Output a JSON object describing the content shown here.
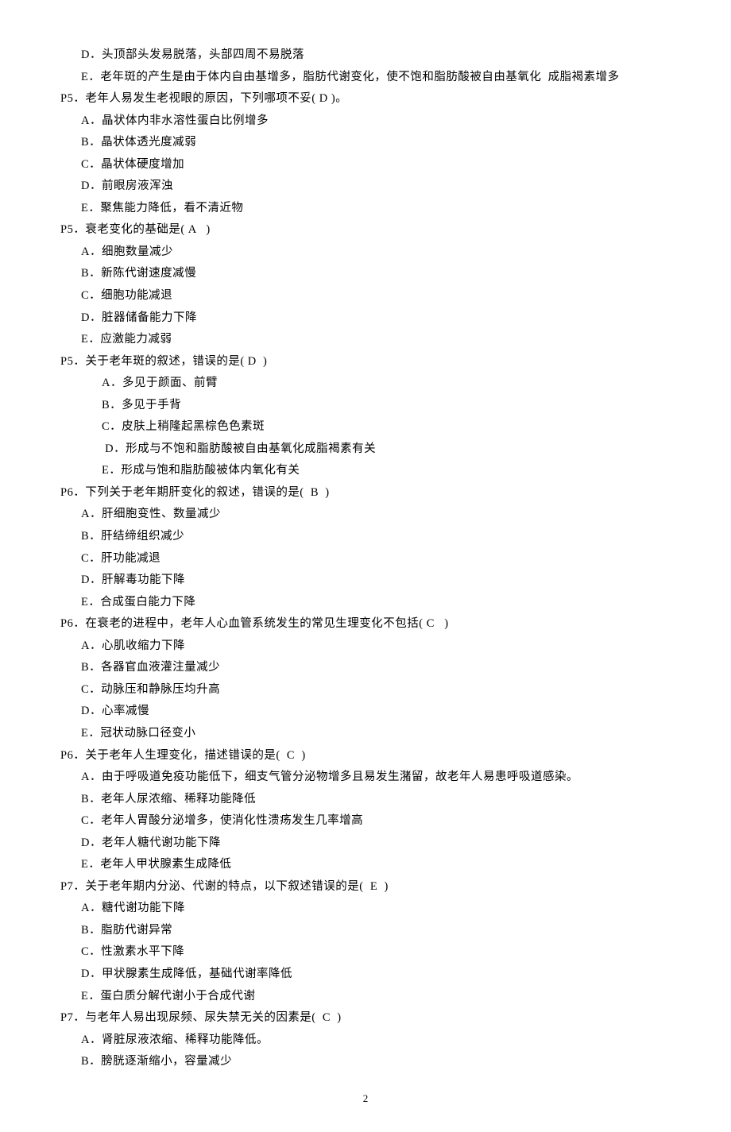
{
  "lines": [
    {
      "cls": "opt",
      "text": "D．头顶部头发易脱落，头部四周不易脱落"
    },
    {
      "cls": "opt",
      "text": "E．老年斑的产生是由于体内自由基增多，脂肪代谢变化，使不饱和脂肪酸被自由基氧化  成脂褐素增多"
    },
    {
      "cls": "q-line",
      "text": "P5．老年人易发生老视眼的原因，下列哪项不妥( D )。"
    },
    {
      "cls": "opt",
      "text": "A．晶状体内非水溶性蛋白比例增多"
    },
    {
      "cls": "opt",
      "text": "B．晶状体透光度减弱"
    },
    {
      "cls": "opt",
      "text": "C．晶状体硬度增加"
    },
    {
      "cls": "opt",
      "text": "D．前眼房液浑浊"
    },
    {
      "cls": "opt",
      "text": "E．聚焦能力降低，看不清近物"
    },
    {
      "cls": "q-line",
      "text": "P5．衰老变化的基础是( A   )"
    },
    {
      "cls": "opt",
      "text": "A．细胞数量减少"
    },
    {
      "cls": "opt",
      "text": "B．新陈代谢速度减慢"
    },
    {
      "cls": "opt",
      "text": "C．细胞功能减退"
    },
    {
      "cls": "opt",
      "text": "D．脏器储备能力下降"
    },
    {
      "cls": "opt",
      "text": "E．应激能力减弱"
    },
    {
      "cls": "q-line",
      "text": "P5．关于老年斑的叙述，错误的是( D  )"
    },
    {
      "cls": "opt-indent",
      "text": "A．多见于颜面、前臂"
    },
    {
      "cls": "opt-indent",
      "text": "B．多见于手背"
    },
    {
      "cls": "opt-indent",
      "text": "C．皮肤上稍隆起黑棕色色素斑"
    },
    {
      "cls": "opt-indent",
      "text": " D．形成与不饱和脂肪酸被自由基氧化成脂褐素有关"
    },
    {
      "cls": "opt-indent",
      "text": "E．形成与饱和脂肪酸被体内氧化有关"
    },
    {
      "cls": "q-line",
      "text": "P6．下列关于老年期肝变化的叙述，错误的是(  B  )"
    },
    {
      "cls": "opt",
      "text": "A．肝细胞变性、数量减少"
    },
    {
      "cls": "opt",
      "text": "B．肝结缔组织减少"
    },
    {
      "cls": "opt",
      "text": "C．肝功能减退"
    },
    {
      "cls": "opt",
      "text": "D．肝解毒功能下降"
    },
    {
      "cls": "opt",
      "text": "E．合成蛋白能力下降"
    },
    {
      "cls": "q-line",
      "text": "P6．在衰老的进程中，老年人心血管系统发生的常见生理变化不包括( C   )"
    },
    {
      "cls": "opt",
      "text": "A．心肌收缩力下降"
    },
    {
      "cls": "opt",
      "text": "B．各器官血液灌注量减少"
    },
    {
      "cls": "opt",
      "text": "C．动脉压和静脉压均升高"
    },
    {
      "cls": "opt",
      "text": "D．心率减慢"
    },
    {
      "cls": "opt",
      "text": "E．冠状动脉口径变小"
    },
    {
      "cls": "q-line",
      "text": "P6．关于老年人生理变化，描述错误的是(  C  )"
    },
    {
      "cls": "opt",
      "text": "A．由于呼吸道免疫功能低下，细支气管分泌物增多且易发生潴留，故老年人易患呼吸道感染。"
    },
    {
      "cls": "opt",
      "text": "B．老年人尿浓缩、稀释功能降低"
    },
    {
      "cls": "opt",
      "text": "C．老年人胃酸分泌增多，使消化性溃疡发生几率增高"
    },
    {
      "cls": "opt",
      "text": "D．老年人糖代谢功能下降"
    },
    {
      "cls": "opt",
      "text": "E．老年人甲状腺素生成降低"
    },
    {
      "cls": "q-line",
      "text": "P7．关于老年期内分泌、代谢的特点，以下叙述错误的是(  E  )"
    },
    {
      "cls": "opt",
      "text": "A．糖代谢功能下降"
    },
    {
      "cls": "opt",
      "text": "B．脂肪代谢异常"
    },
    {
      "cls": "opt",
      "text": "C．性激素水平下降"
    },
    {
      "cls": "opt",
      "text": "D．甲状腺素生成降低，基础代谢率降低"
    },
    {
      "cls": "opt",
      "text": "E．蛋白质分解代谢小于合成代谢"
    },
    {
      "cls": "q-line",
      "text": "P7．与老年人易出现尿频、尿失禁无关的因素是(  C  )"
    },
    {
      "cls": "opt",
      "text": "A．肾脏尿液浓缩、稀释功能降低。"
    },
    {
      "cls": "opt",
      "text": "B．膀胱逐渐缩小，容量减少"
    }
  ],
  "page_number": "2"
}
